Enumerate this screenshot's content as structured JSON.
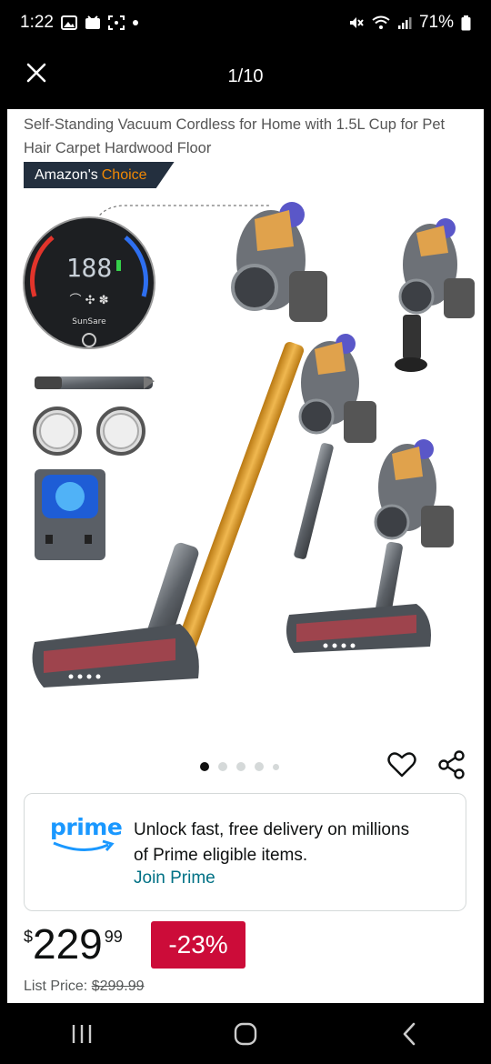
{
  "status_bar": {
    "time": "1:22",
    "battery": "71%",
    "icons": [
      "gallery-icon",
      "app-notification-icon",
      "screenshot-icon",
      "dot-icon",
      "mute-icon",
      "wifi-icon",
      "signal-icon",
      "battery-icon"
    ]
  },
  "viewer": {
    "counter": "1/10",
    "close_icon": "close-icon"
  },
  "product": {
    "title": "Self-Standing Vacuum Cordless for Home with 1.5L Cup for Pet Hair Carpet Hardwood Floor",
    "badge_prefix": "Amazon's",
    "badge_accent": "Choice",
    "image_brand": "SunSare",
    "display_readout": "188",
    "image_dots": 5,
    "active_dot": 0
  },
  "prime": {
    "logo": "prime",
    "text": "Unlock fast, free delivery on millions of Prime eligible items.",
    "link": "Join Prime"
  },
  "pricing": {
    "currency": "$",
    "whole": "229",
    "fraction": "99",
    "discount": "-23%",
    "list_label": "List Price:",
    "list_price": "$299.99"
  },
  "colors": {
    "badge_bg": "#232f3e",
    "badge_accent": "#f08804",
    "prime_blue": "#1a98ff",
    "link": "#007185",
    "discount_red": "#cc0c39",
    "wand_gold": "#d99a2b"
  }
}
